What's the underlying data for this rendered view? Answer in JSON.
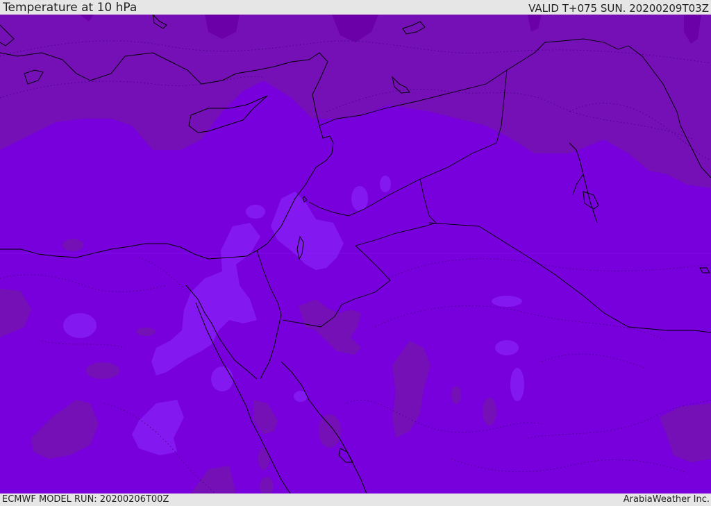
{
  "header": {
    "title": "Temperature at 10 hPa",
    "valid": "VALID T+075 SUN. 20200209T03Z"
  },
  "footer": {
    "model_run": "ECMWF MODEL RUN: 20200206T00Z",
    "credit": "ArabiaWeather Inc."
  },
  "map": {
    "region": "Eastern Mediterranean, Egypt, Levant and Arabian Peninsula",
    "colors": {
      "base_fill": "#7800dc",
      "cooler_fill": "#7410b6",
      "coolest_fill": "#6c00a8",
      "warmer_fill": "#8418f0",
      "warmest_fill": "#8a2cff",
      "coastline": "#000000",
      "isotherm": "#4a0088"
    }
  }
}
